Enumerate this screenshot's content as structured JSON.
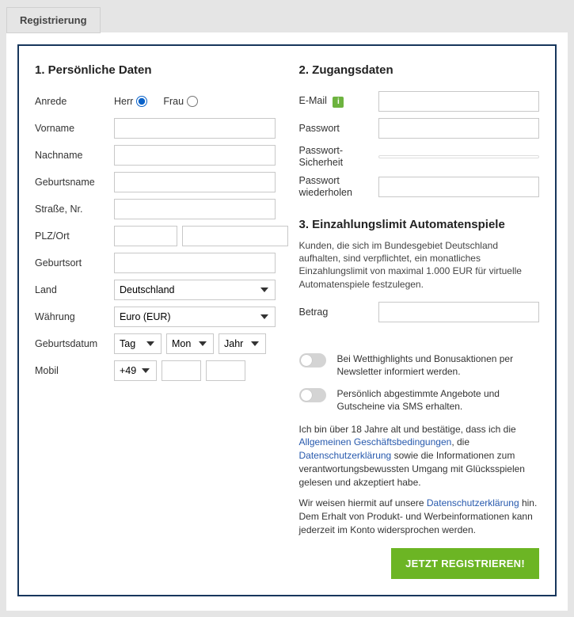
{
  "tab": {
    "label": "Registrierung"
  },
  "section1": {
    "title": "1. Persönliche Daten",
    "labels": {
      "anrede": "Anrede",
      "herr": "Herr",
      "frau": "Frau",
      "vorname": "Vorname",
      "nachname": "Nachname",
      "geburtsname": "Geburtsname",
      "strasse": "Straße, Nr.",
      "plzort": "PLZ/Ort",
      "geburtsort": "Geburtsort",
      "land": "Land",
      "waehrung": "Währung",
      "geburtsdatum": "Geburtsdatum",
      "mobil": "Mobil"
    },
    "values": {
      "land": "Deutschland",
      "waehrung": "Euro (EUR)",
      "tag": "Tag",
      "mon": "Mon",
      "jahr": "Jahr",
      "dial": "+49"
    }
  },
  "section2": {
    "title": "2. Zugangsdaten",
    "labels": {
      "email": "E-Mail",
      "passwort": "Passwort",
      "passwort_sicherheit": "Passwort-Sicherheit",
      "passwort_wdh": "Passwort wiederholen"
    }
  },
  "section3": {
    "title": "3. Einzahlungslimit Automatenspiele",
    "description": "Kunden, die sich im Bundesgebiet Deutschland aufhalten, sind verpflichtet, ein monatliches Einzahlungslimit von maximal 1.000 EUR für virtuelle Automatenspiele festzulegen.",
    "betrag_label": "Betrag"
  },
  "toggles": {
    "newsletter": "Bei Wetthighlights und Bonusaktionen per Newsletter informiert werden.",
    "sms": "Persönlich abgestimmte Angebote und Gutscheine via SMS erhalten."
  },
  "legal": {
    "p1_a": "Ich bin über 18 Jahre alt und bestätige, dass ich die ",
    "p1_link1": "Allgemeinen Geschäftsbedingungen",
    "p1_b": ", die ",
    "p1_link2": "Datenschutzerklärung",
    "p1_c": " sowie die Informationen zum verantwortungsbewussten Umgang mit Glücksspielen gelesen und akzeptiert habe.",
    "p2_a": "Wir weisen hiermit auf unsere ",
    "p2_link": "Datenschutzerklärung",
    "p2_b": " hin. Dem Erhalt von Produkt- und Werbeinformationen kann jederzeit im Konto widersprochen werden."
  },
  "submit": {
    "label": "Jetzt registrieren!"
  },
  "info_icon_char": "i"
}
